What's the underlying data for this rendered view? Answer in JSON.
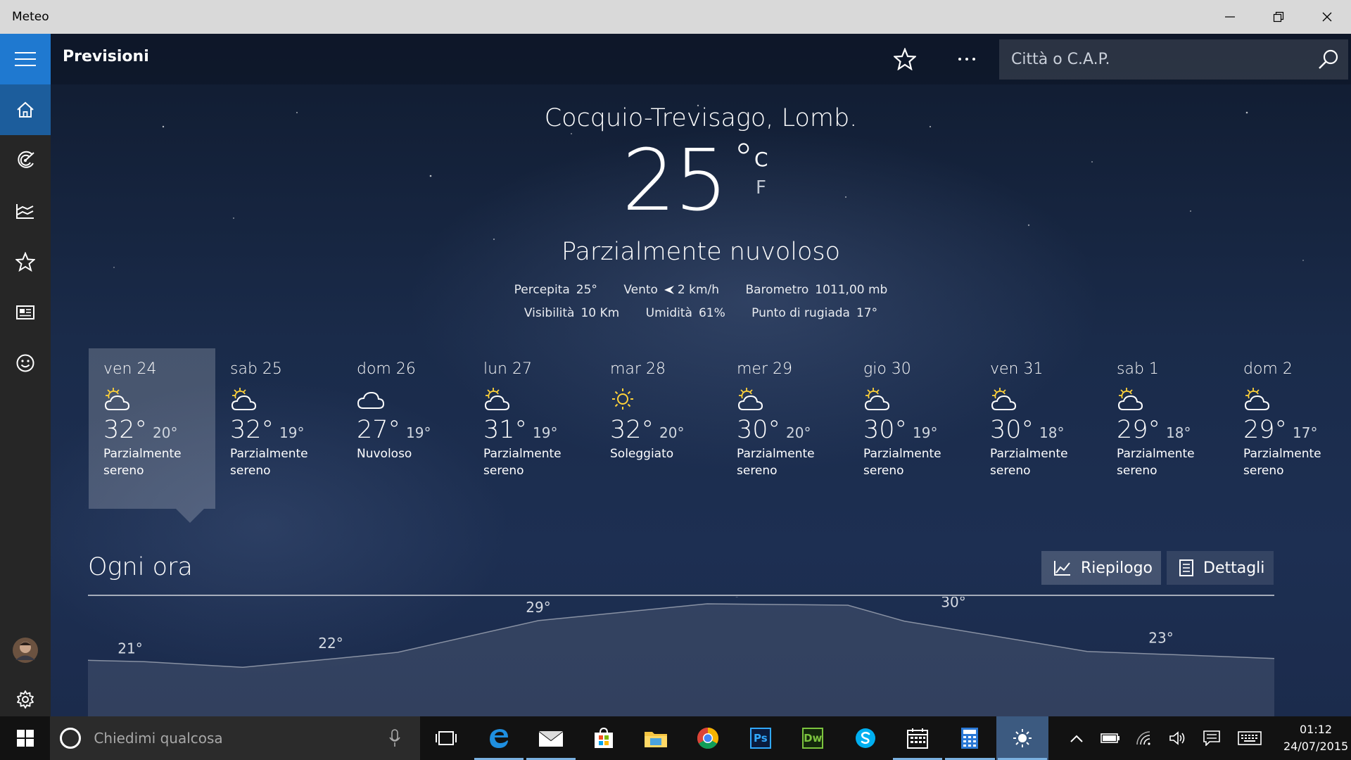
{
  "window": {
    "title": "Meteo"
  },
  "header": {
    "title": "Previsioni",
    "search_placeholder": "Città o C.A.P."
  },
  "sidebar": {
    "items": [
      {
        "icon": "home-icon",
        "label": "Previsioni"
      },
      {
        "icon": "radar-icon",
        "label": "Mappe"
      },
      {
        "icon": "history-icon",
        "label": "Cronologia"
      },
      {
        "icon": "star-icon",
        "label": "Località"
      },
      {
        "icon": "news-icon",
        "label": "Notizie"
      },
      {
        "icon": "smiley-icon",
        "label": "Feedback"
      }
    ]
  },
  "current": {
    "location": "Cocquio-Trevisago, Lomb.",
    "temperature": "25",
    "degree": "°",
    "unit_c": "C",
    "unit_f": "F",
    "condition": "Parzialmente nuvoloso",
    "details": [
      {
        "label": "Percepita",
        "value": "25°"
      },
      {
        "label": "Vento",
        "value": "2 km/h"
      },
      {
        "label": "Barometro",
        "value": "1011,00 mb"
      },
      {
        "label": "Visibilità",
        "value": "10 Km"
      },
      {
        "label": "Umidità",
        "value": "61%"
      },
      {
        "label": "Punto di rugiada",
        "value": "17°"
      }
    ]
  },
  "daily": [
    {
      "day": "ven 24",
      "hi": "32°",
      "lo": "20°",
      "cond": "Parzialmente sereno",
      "icon": "partly-sunny-icon"
    },
    {
      "day": "sab 25",
      "hi": "32°",
      "lo": "19°",
      "cond": "Parzialmente sereno",
      "icon": "partly-sunny-icon"
    },
    {
      "day": "dom 26",
      "hi": "27°",
      "lo": "19°",
      "cond": "Nuvoloso",
      "icon": "cloudy-icon"
    },
    {
      "day": "lun 27",
      "hi": "31°",
      "lo": "19°",
      "cond": "Parzialmente sereno",
      "icon": "partly-sunny-icon"
    },
    {
      "day": "mar 28",
      "hi": "32°",
      "lo": "20°",
      "cond": "Soleggiato",
      "icon": "sunny-icon"
    },
    {
      "day": "mer 29",
      "hi": "30°",
      "lo": "20°",
      "cond": "Parzialmente sereno",
      "icon": "partly-sunny-icon"
    },
    {
      "day": "gio 30",
      "hi": "30°",
      "lo": "19°",
      "cond": "Parzialmente sereno",
      "icon": "partly-sunny-icon"
    },
    {
      "day": "ven 31",
      "hi": "30°",
      "lo": "18°",
      "cond": "Parzialmente sereno",
      "icon": "partly-sunny-icon"
    },
    {
      "day": "sab 1",
      "hi": "29°",
      "lo": "18°",
      "cond": "Parzialmente sereno",
      "icon": "partly-sunny-icon"
    },
    {
      "day": "dom 2",
      "hi": "29°",
      "lo": "17°",
      "cond": "Parzialmente sereno",
      "icon": "partly-sunny-icon"
    }
  ],
  "hourly": {
    "title": "Ogni ora",
    "summary_label": "Riepilogo",
    "details_label": "Dettagli",
    "temps": [
      21,
      22,
      29,
      32,
      30,
      23
    ]
  },
  "taskbar": {
    "search_placeholder": "Chiedimi qualcosa",
    "time": "01:12",
    "date": "24/07/2015",
    "apps": [
      "task-view-icon",
      "edge-icon",
      "mail-icon",
      "store-icon",
      "explorer-icon",
      "chrome-icon",
      "photoshop-icon",
      "dreamweaver-icon",
      "skype-icon",
      "calendar-icon",
      "calculator-icon",
      "weather-icon"
    ],
    "app_labels": {
      "photoshop": "Ps",
      "dreamweaver": "Dw"
    }
  },
  "colors": {
    "sidebar": "#262626",
    "accent": "#1f79d0",
    "taskbar": "#121212"
  }
}
